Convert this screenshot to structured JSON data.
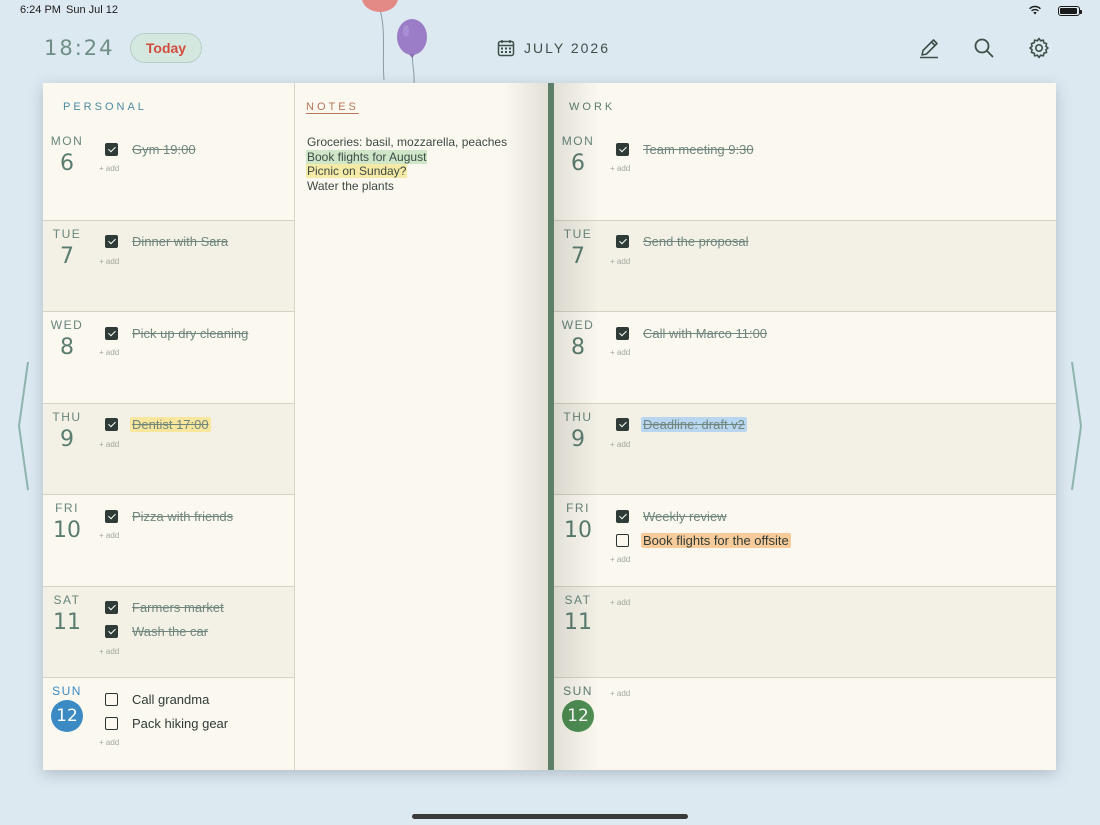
{
  "status": {
    "time": "6:24 PM",
    "date": "Sun Jul 12"
  },
  "header": {
    "clock": "18:24",
    "today_label": "Today",
    "month_label": "JULY 2026"
  },
  "personal": {
    "title": "PERSONAL",
    "days": [
      {
        "dow": "MON",
        "num": "6",
        "tasks": [
          {
            "text": "Gym 19:00",
            "done": true
          }
        ]
      },
      {
        "dow": "TUE",
        "num": "7",
        "tasks": [
          {
            "text": "Dinner with Sara",
            "done": true
          }
        ]
      },
      {
        "dow": "WED",
        "num": "8",
        "tasks": [
          {
            "text": "Pick up dry cleaning",
            "done": true
          }
        ]
      },
      {
        "dow": "THU",
        "num": "9",
        "tasks": [
          {
            "text": "Dentist 17:00",
            "done": true,
            "highlight": "yellow"
          }
        ]
      },
      {
        "dow": "FRI",
        "num": "10",
        "tasks": [
          {
            "text": "Pizza with friends",
            "done": true
          }
        ]
      },
      {
        "dow": "SAT",
        "num": "11",
        "tasks": [
          {
            "text": "Farmers market",
            "done": true
          },
          {
            "text": "Wash the car",
            "done": true
          }
        ]
      },
      {
        "dow": "SUN",
        "num": "12",
        "today": true,
        "tasks": [
          {
            "text": "Call grandma",
            "done": false
          },
          {
            "text": "Pack hiking gear",
            "done": false
          }
        ]
      }
    ]
  },
  "notes": {
    "title": "NOTES",
    "lines": [
      {
        "text": "Groceries: basil, mozzarella, peaches"
      },
      {
        "text": "Book flights for August",
        "highlight": "green"
      },
      {
        "text": "Picnic on Sunday?",
        "highlight": "yellow"
      },
      {
        "text": "Water the plants"
      }
    ]
  },
  "work": {
    "title": "WORK",
    "days": [
      {
        "dow": "MON",
        "num": "6",
        "tasks": [
          {
            "text": "Team meeting 9:30",
            "done": true
          }
        ]
      },
      {
        "dow": "TUE",
        "num": "7",
        "tasks": [
          {
            "text": "Send the proposal",
            "done": true
          }
        ]
      },
      {
        "dow": "WED",
        "num": "8",
        "tasks": [
          {
            "text": "Call with Marco 11:00",
            "done": true
          }
        ]
      },
      {
        "dow": "THU",
        "num": "9",
        "tasks": [
          {
            "text": "Deadline: draft v2",
            "done": true,
            "highlight": "blue"
          }
        ]
      },
      {
        "dow": "FRI",
        "num": "10",
        "tasks": [
          {
            "text": "Weekly review",
            "done": true
          },
          {
            "text": "Book flights for the offsite",
            "done": false,
            "highlight": "peach"
          }
        ]
      },
      {
        "dow": "SAT",
        "num": "11",
        "tasks": []
      },
      {
        "dow": "SUN",
        "num": "12",
        "today": true,
        "tasks": []
      }
    ]
  },
  "add_label": "+ add",
  "colors": {
    "background": "#dde9f1",
    "paper": "#fbf9ef",
    "spine": "#5e8069",
    "today_personal": "#3b8ac3",
    "today_work": "#4f8f53",
    "today_button_text": "#d24b3f"
  },
  "icons": {
    "edit": "pencil-icon",
    "search": "search-icon",
    "settings": "gear-icon",
    "calendar": "calendar-icon"
  }
}
